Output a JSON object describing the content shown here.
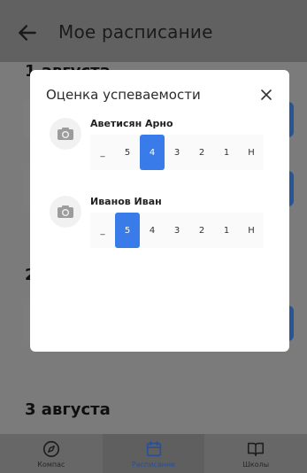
{
  "app": {
    "title": "Мое расписание",
    "section_1_heading": "1 августа",
    "section_2_heading": "2",
    "section_3_heading": "3 августа"
  },
  "bottom_nav": [
    {
      "label": "Компас",
      "icon": "compass-icon",
      "active": false
    },
    {
      "label": "Расписание",
      "icon": "calendar-icon",
      "active": true
    },
    {
      "label": "Школы",
      "icon": "book-icon",
      "active": false
    }
  ],
  "modal": {
    "title": "Оценка успеваемости",
    "students": [
      {
        "name": "Аветисян Арно",
        "selected": "4"
      },
      {
        "name": "Иванов Иван",
        "selected": "5"
      }
    ],
    "grade_options": [
      "_",
      "5",
      "4",
      "3",
      "2",
      "1",
      "Н"
    ]
  },
  "colors": {
    "accent": "#3a7bea",
    "modal_bg": "#ffffff"
  }
}
